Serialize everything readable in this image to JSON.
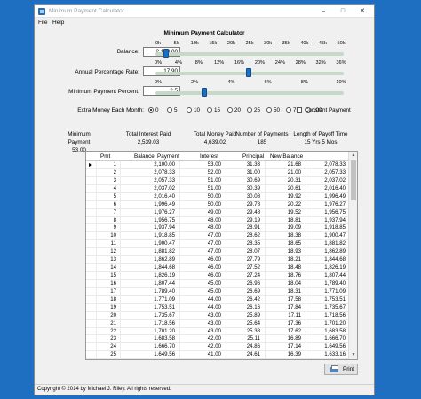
{
  "window": {
    "title": "Minimum Payment Calculator",
    "minimize": "–",
    "maximize": "□",
    "close": "✕"
  },
  "menu": {
    "file": "File",
    "help": "Help"
  },
  "heading": "Minimum Payment Calculator",
  "balance": {
    "label": "Balance:",
    "value": "2,100.00",
    "ticks": [
      "0k",
      "5k",
      "10k",
      "15k",
      "20k",
      "25k",
      "30k",
      "35k",
      "40k",
      "45k",
      "50k"
    ],
    "slider_value": 2100
  },
  "apr": {
    "label": "Annual Percentage Rate:",
    "value": "17.90",
    "ticks": [
      "0%",
      "4%",
      "8%",
      "12%",
      "16%",
      "20%",
      "24%",
      "28%",
      "32%",
      "36%"
    ],
    "slider_value": 17.9
  },
  "min_pct": {
    "label": "Minimum Payment Percent:",
    "value": "2.5",
    "ticks": [
      "0%",
      "2%",
      "4%",
      "6%",
      "8%",
      "10%"
    ],
    "slider_value": 2.5
  },
  "extra": {
    "label": "Extra Money Each Month:",
    "options": [
      "0",
      "5",
      "10",
      "15",
      "20",
      "25",
      "50",
      "75",
      "100"
    ],
    "selected": "0"
  },
  "constant_payment": {
    "label": "Constant Payment",
    "checked": false
  },
  "summary": {
    "min_payment_label": "Minimum Payment",
    "min_payment_value": "53.00",
    "total_interest_label": "Total Interest Paid",
    "total_interest_value": "2,539.03",
    "total_money_label": "Total Money Paid",
    "total_money_value": "4,639.02",
    "num_payments_label": "Number of Payments",
    "num_payments_value": "185",
    "payoff_label": "Length of Payoff Time",
    "payoff_value": "15 Yrs 5 Mos"
  },
  "table": {
    "columns": [
      "Pmt",
      "Balance",
      "Payment",
      "Interest",
      "Principal",
      "New Balance"
    ],
    "rows": [
      [
        "1",
        "2,100.00",
        "53.00",
        "31.33",
        "21.68",
        "2,078.33"
      ],
      [
        "2",
        "2,078.33",
        "52.00",
        "31.00",
        "21.00",
        "2,057.33"
      ],
      [
        "3",
        "2,057.33",
        "51.00",
        "30.69",
        "20.31",
        "2,037.02"
      ],
      [
        "4",
        "2,037.02",
        "51.00",
        "30.39",
        "20.61",
        "2,016.40"
      ],
      [
        "5",
        "2,016.40",
        "50.00",
        "30.08",
        "19.92",
        "1,996.49"
      ],
      [
        "6",
        "1,996.49",
        "50.00",
        "29.78",
        "20.22",
        "1,976.27"
      ],
      [
        "7",
        "1,976.27",
        "49.00",
        "29.48",
        "19.52",
        "1,956.75"
      ],
      [
        "8",
        "1,956.75",
        "48.00",
        "29.19",
        "18.81",
        "1,937.94"
      ],
      [
        "9",
        "1,937.94",
        "48.00",
        "28.91",
        "19.09",
        "1,918.85"
      ],
      [
        "10",
        "1,918.85",
        "47.00",
        "28.62",
        "18.38",
        "1,900.47"
      ],
      [
        "11",
        "1,900.47",
        "47.00",
        "28.35",
        "18.65",
        "1,881.82"
      ],
      [
        "12",
        "1,881.82",
        "47.00",
        "28.07",
        "18.93",
        "1,862.89"
      ],
      [
        "13",
        "1,862.89",
        "46.00",
        "27.79",
        "18.21",
        "1,844.68"
      ],
      [
        "14",
        "1,844.68",
        "46.00",
        "27.52",
        "18.48",
        "1,826.19"
      ],
      [
        "15",
        "1,826.19",
        "46.00",
        "27.24",
        "18.76",
        "1,807.44"
      ],
      [
        "16",
        "1,807.44",
        "45.00",
        "26.96",
        "18.04",
        "1,789.40"
      ],
      [
        "17",
        "1,789.40",
        "45.00",
        "26.69",
        "18.31",
        "1,771.09"
      ],
      [
        "18",
        "1,771.09",
        "44.00",
        "26.42",
        "17.58",
        "1,753.51"
      ],
      [
        "19",
        "1,753.51",
        "44.00",
        "26.16",
        "17.84",
        "1,735.67"
      ],
      [
        "20",
        "1,735.67",
        "43.00",
        "25.89",
        "17.11",
        "1,718.56"
      ],
      [
        "21",
        "1,718.56",
        "43.00",
        "25.64",
        "17.36",
        "1,701.20"
      ],
      [
        "22",
        "1,701.20",
        "43.00",
        "25.38",
        "17.62",
        "1,683.58"
      ],
      [
        "23",
        "1,683.58",
        "42.00",
        "25.11",
        "16.89",
        "1,666.70"
      ],
      [
        "24",
        "1,666.70",
        "42.00",
        "24.86",
        "17.14",
        "1,649.56"
      ],
      [
        "25",
        "1,649.56",
        "41.00",
        "24.61",
        "16.39",
        "1,633.16"
      ]
    ]
  },
  "print_label": "Print",
  "status": "Copyright © 2014 by Michael J. Riley.  All rights reserved."
}
